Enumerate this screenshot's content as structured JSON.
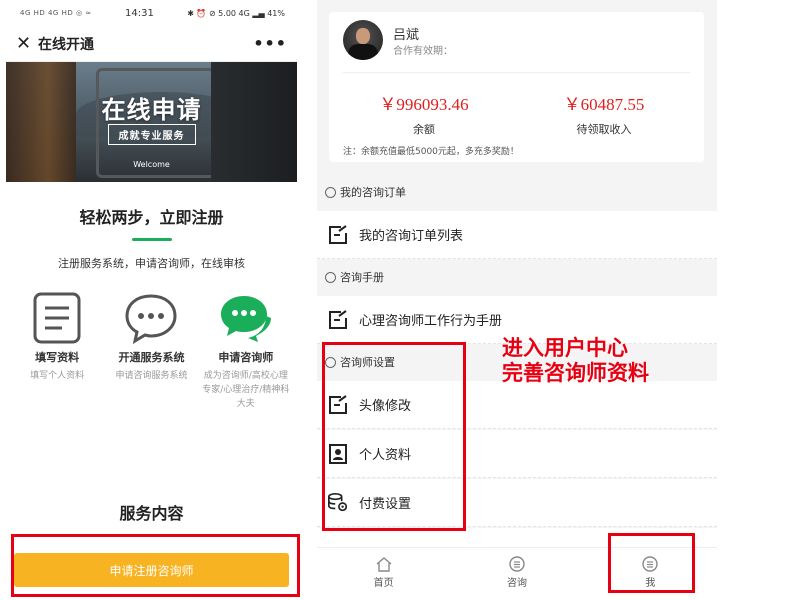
{
  "left_phone": {
    "status": {
      "left": "4G HD 4G HD ◎ ≈",
      "time": "14:31",
      "right": "✱ ⏰ ⊘ 5.00 4G ▂▄ 41%"
    },
    "nav": {
      "title": "在线开通",
      "close_icon": "close-icon",
      "more": "•••"
    },
    "banner": {
      "title": "在线申请",
      "subtitle": "成就专业服务",
      "welcome": "Welcome"
    },
    "section_title": "轻松两步，立即注册",
    "section_desc": "注册服务系统，申请咨询师，在线审核",
    "features": [
      {
        "icon": "document-icon",
        "title": "填写资料",
        "desc": "填写个人资料"
      },
      {
        "icon": "chat-bubble-icon",
        "title": "开通服务系统",
        "desc": "申请咨询服务系统"
      },
      {
        "icon": "wechat-icon",
        "title": "申请咨询师",
        "desc": "成为咨询师/高校心理专家/心理治疗/精神科大夫"
      }
    ],
    "service_title": "服务内容",
    "apply_button": "申请注册咨询师",
    "accent_color": "#1aad5a",
    "button_color": "#f7b322"
  },
  "right_phone": {
    "user": {
      "name": "吕斌",
      "status": "合作有效期：",
      "balance": "￥996093.46",
      "balance_label": "余额",
      "pending": "￥60487.55",
      "pending_label": "待领取收入",
      "note": "注：余额充值最低5000元起，多充多奖励！"
    },
    "sections": [
      {
        "title": "我的咨询订单",
        "items": [
          {
            "icon": "edit-icon",
            "label": "我的咨询订单列表"
          }
        ]
      },
      {
        "title": "咨询手册",
        "items": [
          {
            "icon": "edit-icon",
            "label": "心理咨询师工作行为手册"
          }
        ]
      },
      {
        "title": "咨询师设置",
        "items": [
          {
            "icon": "edit-icon",
            "label": "头像修改"
          },
          {
            "icon": "id-card-icon",
            "label": "个人资料"
          },
          {
            "icon": "coins-gear-icon",
            "label": "付费设置"
          }
        ]
      }
    ],
    "tabs": [
      {
        "icon": "home-icon",
        "label": "首页"
      },
      {
        "icon": "menu-circle-icon",
        "label": "咨询"
      },
      {
        "icon": "menu-circle-icon",
        "label": "我"
      }
    ],
    "amount_color": "#e02020"
  },
  "annotation": {
    "line1": "进入用户中心",
    "line2": "完善咨询师资料",
    "color": "#e60012"
  }
}
